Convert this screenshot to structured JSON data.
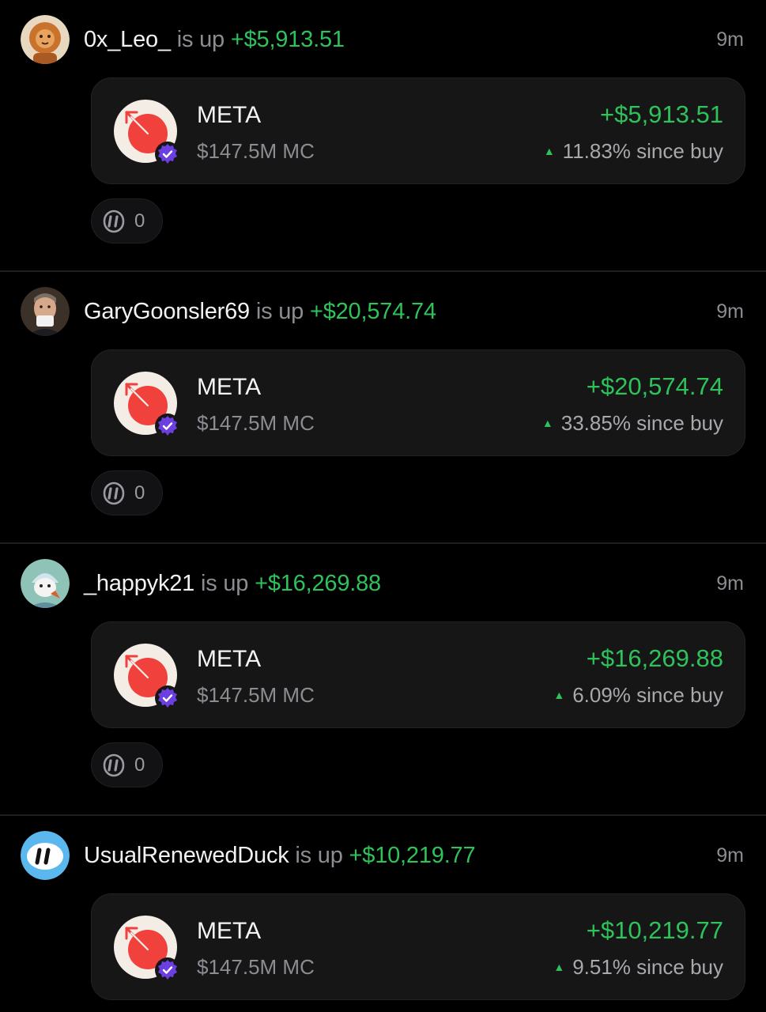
{
  "feed": {
    "posts": [
      {
        "avatar": "lion-avatar",
        "username": "0x_Leo_",
        "verb": " is up ",
        "amount": "+$5,913.51",
        "time": "9m",
        "token": {
          "logo": "meta-token-logo",
          "ticker": "META",
          "market_cap": "$147.5M MC",
          "pnl": "+$5,913.51",
          "change": "11.83% since buy"
        },
        "reactions": "0"
      },
      {
        "avatar": "person-avatar",
        "username": "GaryGoonsler69",
        "verb": " is up ",
        "amount": "+$20,574.74",
        "time": "9m",
        "token": {
          "logo": "meta-token-logo",
          "ticker": "META",
          "market_cap": "$147.5M MC",
          "pnl": "+$20,574.74",
          "change": "33.85% since buy"
        },
        "reactions": "0"
      },
      {
        "avatar": "cartoon-avatar",
        "username": "_happyk21",
        "verb": " is up ",
        "amount": "+$16,269.88",
        "time": "9m",
        "token": {
          "logo": "meta-token-logo",
          "ticker": "META",
          "market_cap": "$147.5M MC",
          "pnl": "+$16,269.88",
          "change": "6.09% since buy"
        },
        "reactions": "0"
      },
      {
        "avatar": "app-logo-avatar",
        "username": "UsualRenewedDuck",
        "verb": " is up ",
        "amount": "+$10,219.77",
        "time": "9m",
        "token": {
          "logo": "meta-token-logo",
          "ticker": "META",
          "market_cap": "$147.5M MC",
          "pnl": "+$10,219.77",
          "change": "9.51% since buy"
        },
        "reactions": null
      }
    ]
  },
  "colors": {
    "background": "#000000",
    "card": "#161617",
    "gain": "#2fc25b",
    "muted": "#8c8c92",
    "verified": "#6b3fe0",
    "token_red": "#f0413c"
  }
}
